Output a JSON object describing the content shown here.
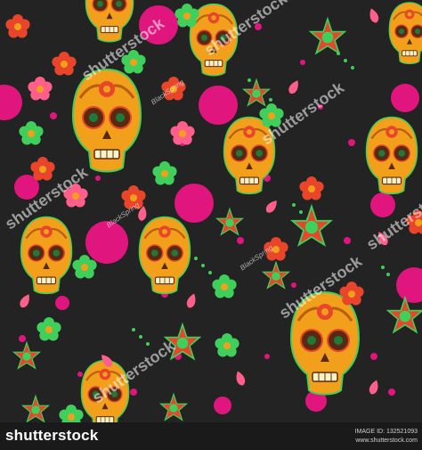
{
  "image": {
    "description_colors": {
      "background": "#232323",
      "skull": "#f2a01c",
      "skull_dark": "#b85f0c",
      "magenta": "#e0157e",
      "green": "#3fcf5a",
      "red": "#e8452a",
      "pink": "#ff5f8a"
    },
    "watermarks": {
      "brand_mark": "shutterstock",
      "artist": "BlackSpring"
    }
  },
  "footer": {
    "brand": "shutterstock",
    "image_id": "IMAGE ID: 132521093",
    "site": "www.shutterstock.com"
  }
}
